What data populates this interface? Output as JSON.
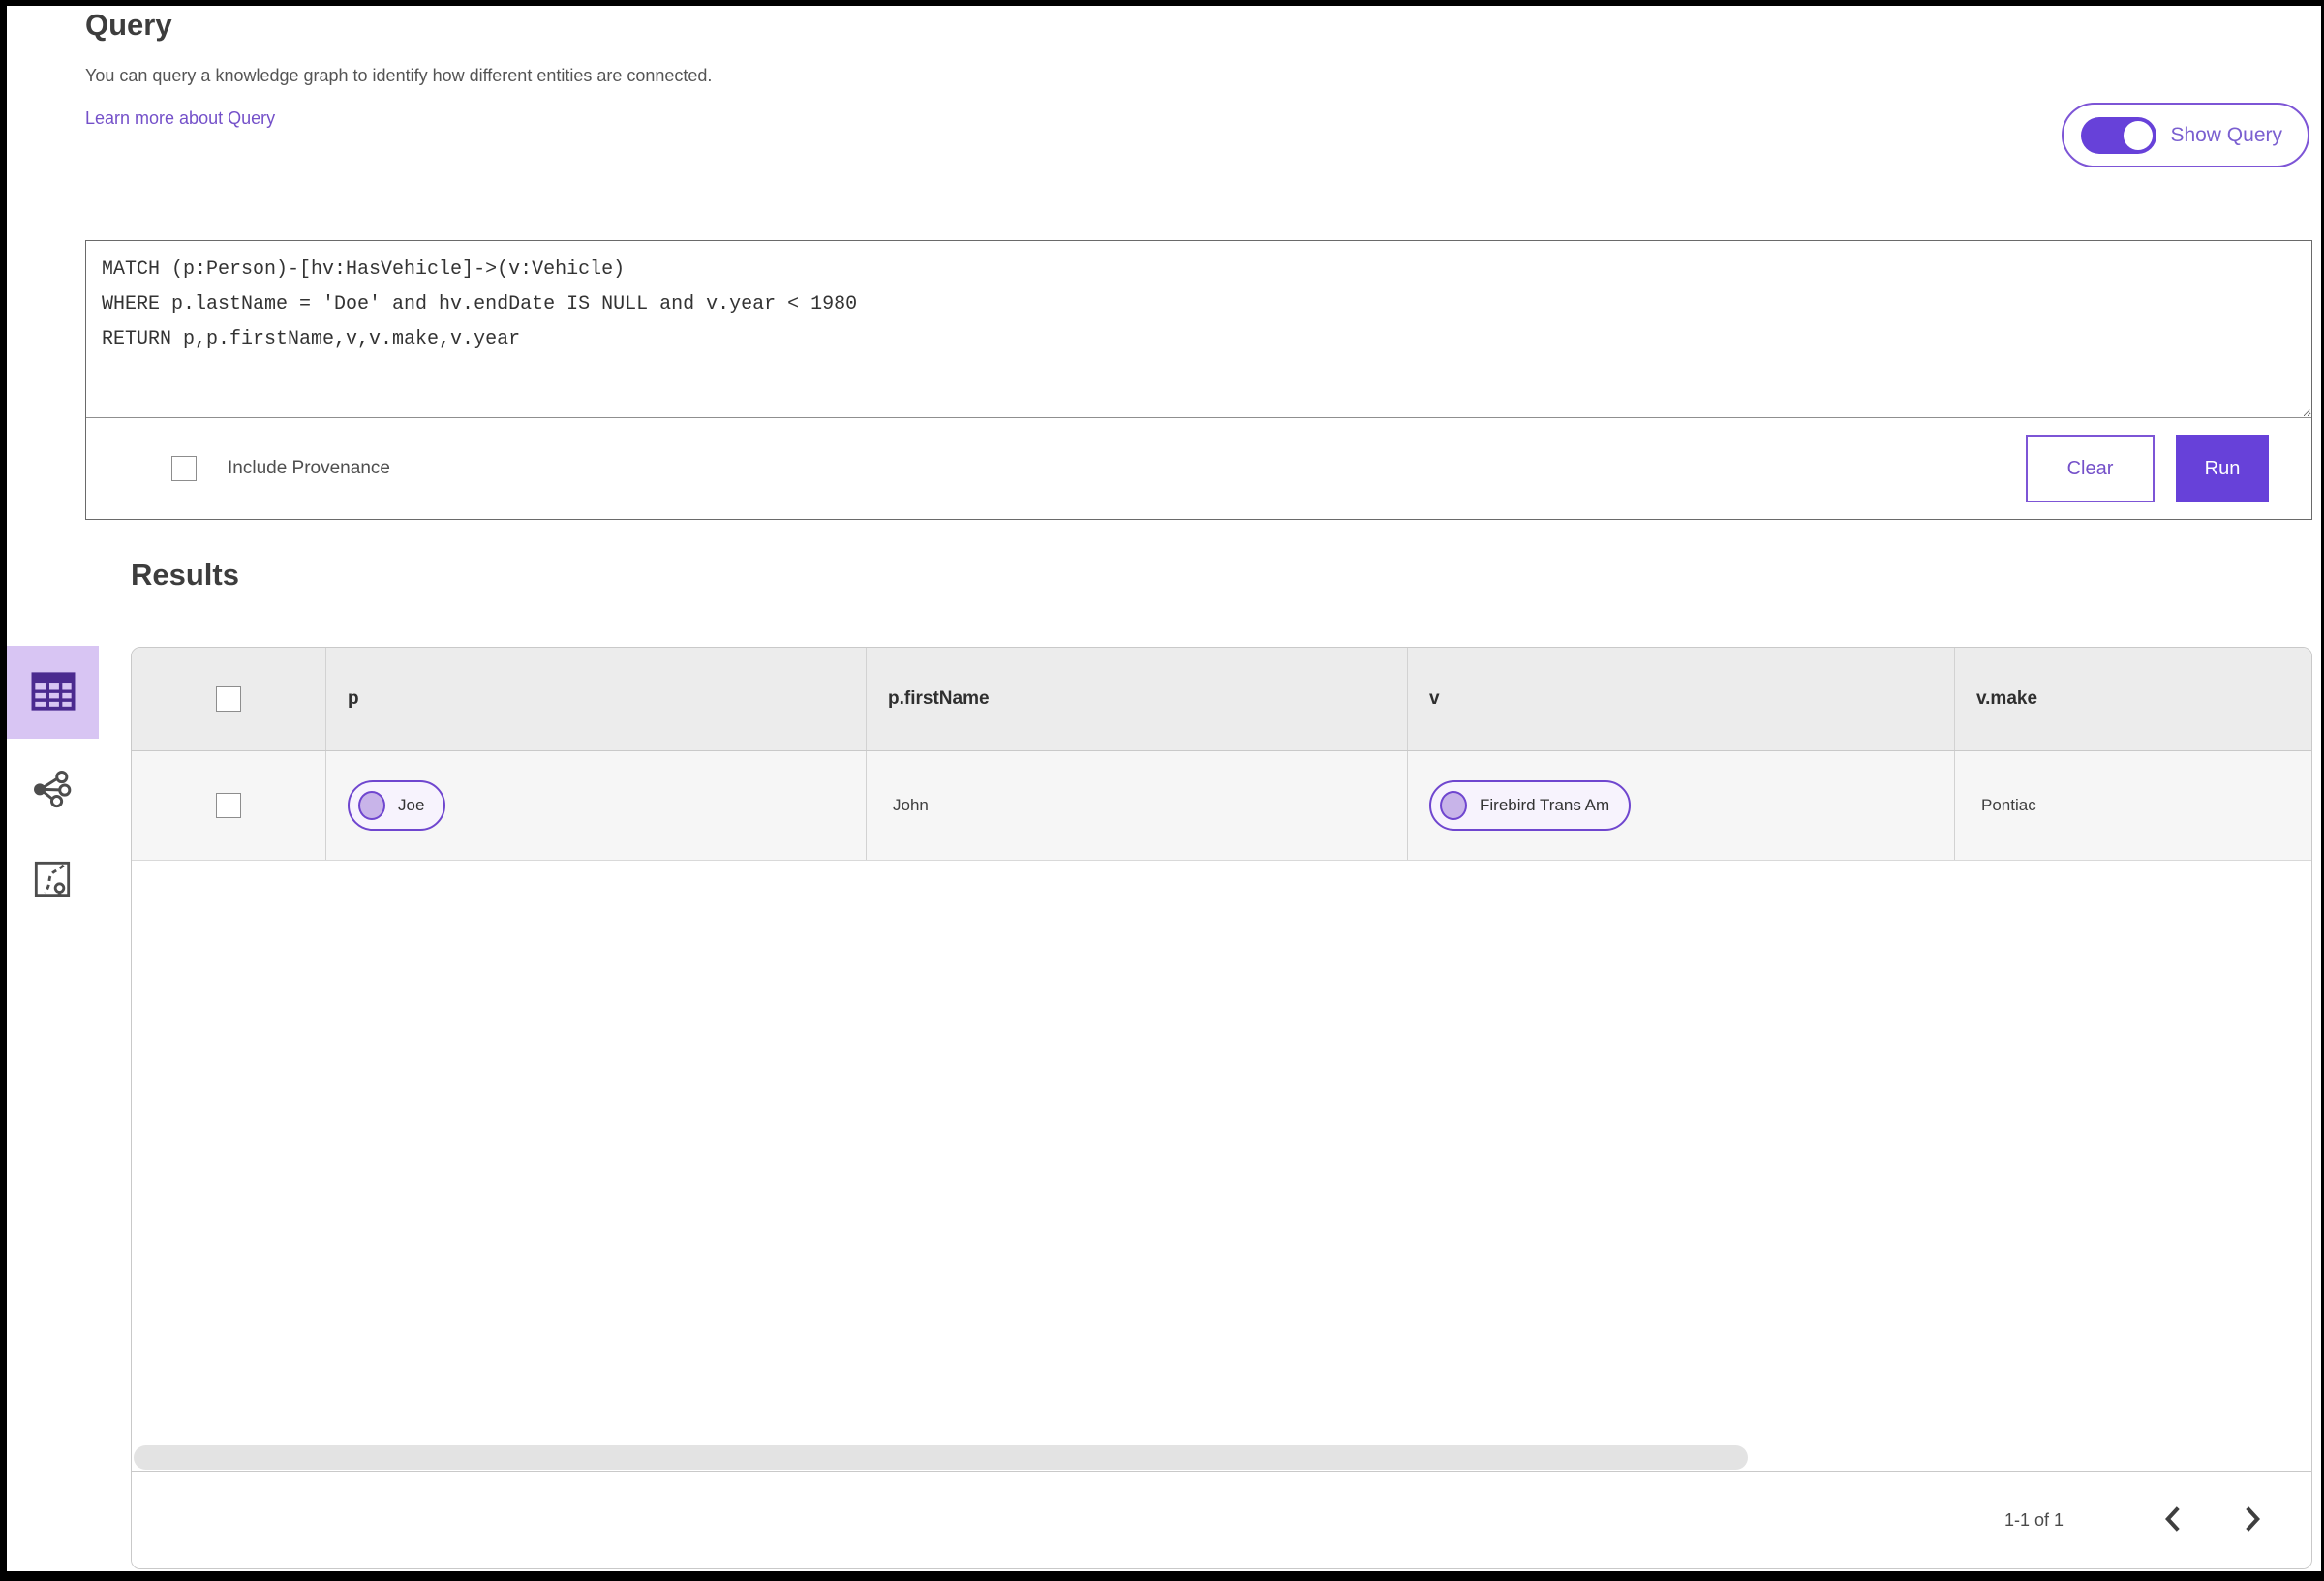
{
  "header": {
    "title": "Query",
    "description": "You can query a knowledge graph to identify how different entities are connected.",
    "learn_more_link": "Learn more about Query",
    "show_query_toggle": {
      "label": "Show Query",
      "state": "on"
    }
  },
  "query_editor": {
    "code": "MATCH (p:Person)-[hv:HasVehicle]->(v:Vehicle)\nWHERE p.lastName = 'Doe' and hv.endDate IS NULL and v.year < 1980\nRETURN p,p.firstName,v,v.make,v.year",
    "include_provenance": {
      "label": "Include Provenance",
      "checked": false
    },
    "buttons": {
      "clear": "Clear",
      "run": "Run"
    }
  },
  "results": {
    "title": "Results",
    "view_switcher": {
      "views": [
        "table-view",
        "graph-view",
        "map-view"
      ],
      "active_view": "table-view"
    },
    "table": {
      "columns": [
        "p",
        "p.firstName",
        "v",
        "v.make"
      ],
      "rows": [
        {
          "p_entity": "Joe",
          "p_firstName": "John",
          "v_entity": "Firebird Trans Am",
          "v_make": "Pontiac"
        }
      ]
    },
    "pagination": {
      "range_label": "1-1 of 1"
    }
  },
  "colors": {
    "accent_purple": "#6741d9",
    "accent_light_purple": "#d8c5f3",
    "link_purple": "#7450c9",
    "table_header_gray": "#ececec",
    "table_row_gray": "#f6f6f6"
  }
}
